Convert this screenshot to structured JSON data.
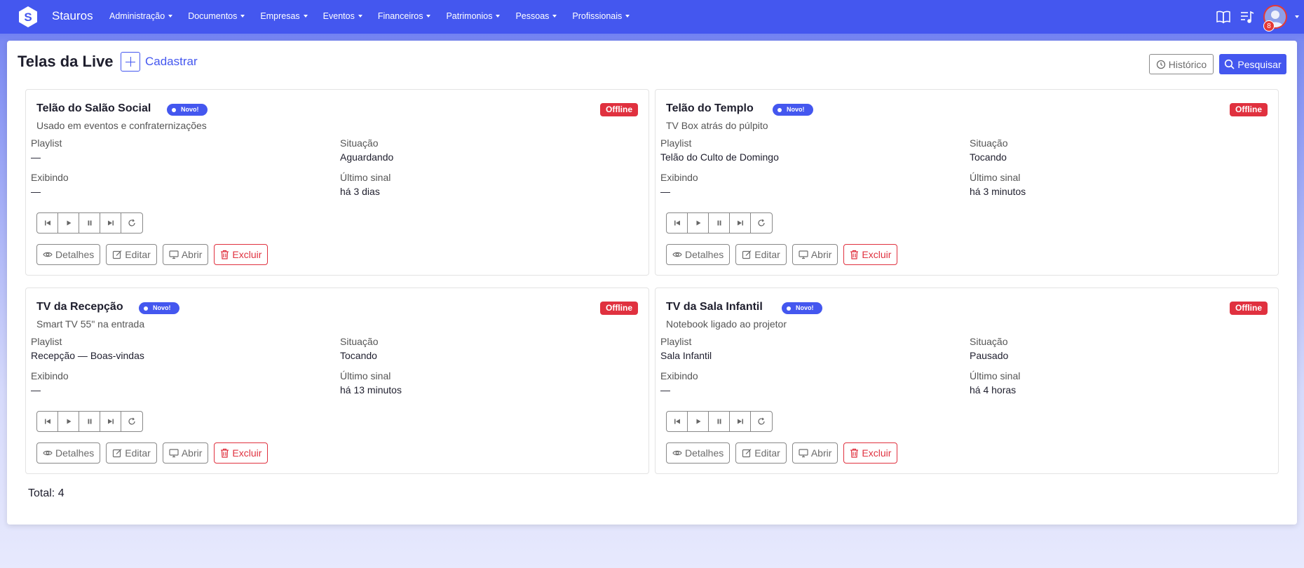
{
  "navbar": {
    "brand": "Stauros",
    "menu": [
      {
        "label": "Administração"
      },
      {
        "label": "Documentos"
      },
      {
        "label": "Empresas"
      },
      {
        "label": "Eventos"
      },
      {
        "label": "Financeiros"
      },
      {
        "label": "Patrimonios"
      },
      {
        "label": "Pessoas"
      },
      {
        "label": "Profissionais"
      }
    ],
    "notification_count": "8"
  },
  "page": {
    "title": "Telas da Live",
    "create_label": "Cadastrar",
    "history_label": "Histórico",
    "search_label": "Pesquisar",
    "total_label": "Total: 4"
  },
  "labels": {
    "playlist": "Playlist",
    "situacao": "Situação",
    "exibindo": "Exibindo",
    "ultimo_sinal": "Último sinal",
    "novo": "Novo!",
    "offline": "Offline",
    "detalhes": "Detalhes",
    "editar": "Editar",
    "abrir": "Abrir",
    "excluir": "Excluir"
  },
  "screens": [
    {
      "title": "Telão do Salão Social",
      "description": "Usado em eventos e confraternizações",
      "playlist": "—",
      "situacao": "Aguardando",
      "exibindo": "—",
      "ultimo_sinal": "há 3 dias"
    },
    {
      "title": "Telão do Templo",
      "description": "TV Box atrás do púlpito",
      "playlist": "Telão do Culto de Domingo",
      "situacao": "Tocando",
      "exibindo": "—",
      "ultimo_sinal": "há 3 minutos"
    },
    {
      "title": "TV da Recepção",
      "description": "Smart TV 55\" na entrada",
      "playlist": "Recepção — Boas-vindas",
      "situacao": "Tocando",
      "exibindo": "—",
      "ultimo_sinal": "há 13 minutos"
    },
    {
      "title": "TV da Sala Infantil",
      "description": "Notebook ligado ao projetor",
      "playlist": "Sala Infantil",
      "situacao": "Pausado",
      "exibindo": "—",
      "ultimo_sinal": "há 4 horas"
    }
  ],
  "colors": {
    "primary": "#4457ef",
    "danger": "#e0313f"
  },
  "icons": [
    "logo-icon",
    "book-icon",
    "playlist-icon",
    "clock-icon",
    "search-icon",
    "skip-back-icon",
    "play-icon",
    "pause-icon",
    "skip-forward-icon",
    "refresh-icon",
    "eye-icon",
    "edit-icon",
    "monitor-icon",
    "trash-icon"
  ]
}
